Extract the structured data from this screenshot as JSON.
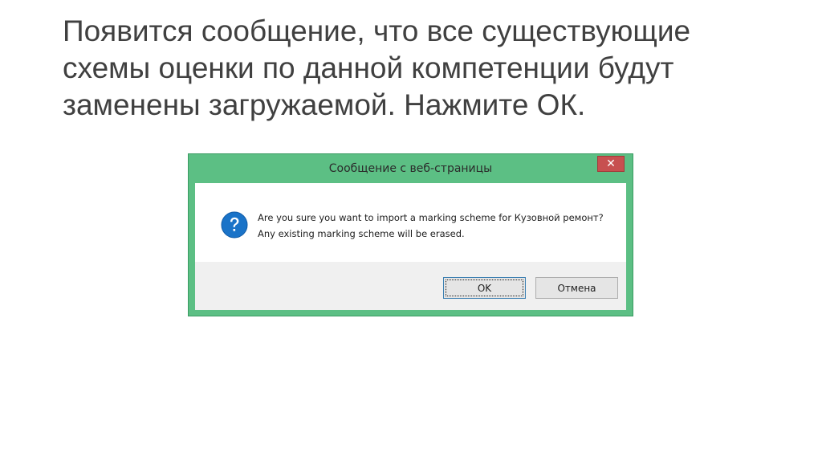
{
  "slide": {
    "title_lines": [
      "Появится сообщение, что все существующие",
      "схемы оценки по данной компетенции будут",
      "заменены загружаемой. Нажмите ОК."
    ]
  },
  "dialog": {
    "title": "Сообщение с веб-страницы",
    "close_glyph": "✕",
    "icon": "question-icon",
    "message": "Are you sure you want to import a marking scheme for Кузовной ремонт? Any existing marking scheme will be erased.",
    "ok_label": "OK",
    "cancel_label": "Отмена",
    "colors": {
      "frame": "#5cbf84",
      "close": "#c75050",
      "icon": "#1a73c8"
    }
  }
}
